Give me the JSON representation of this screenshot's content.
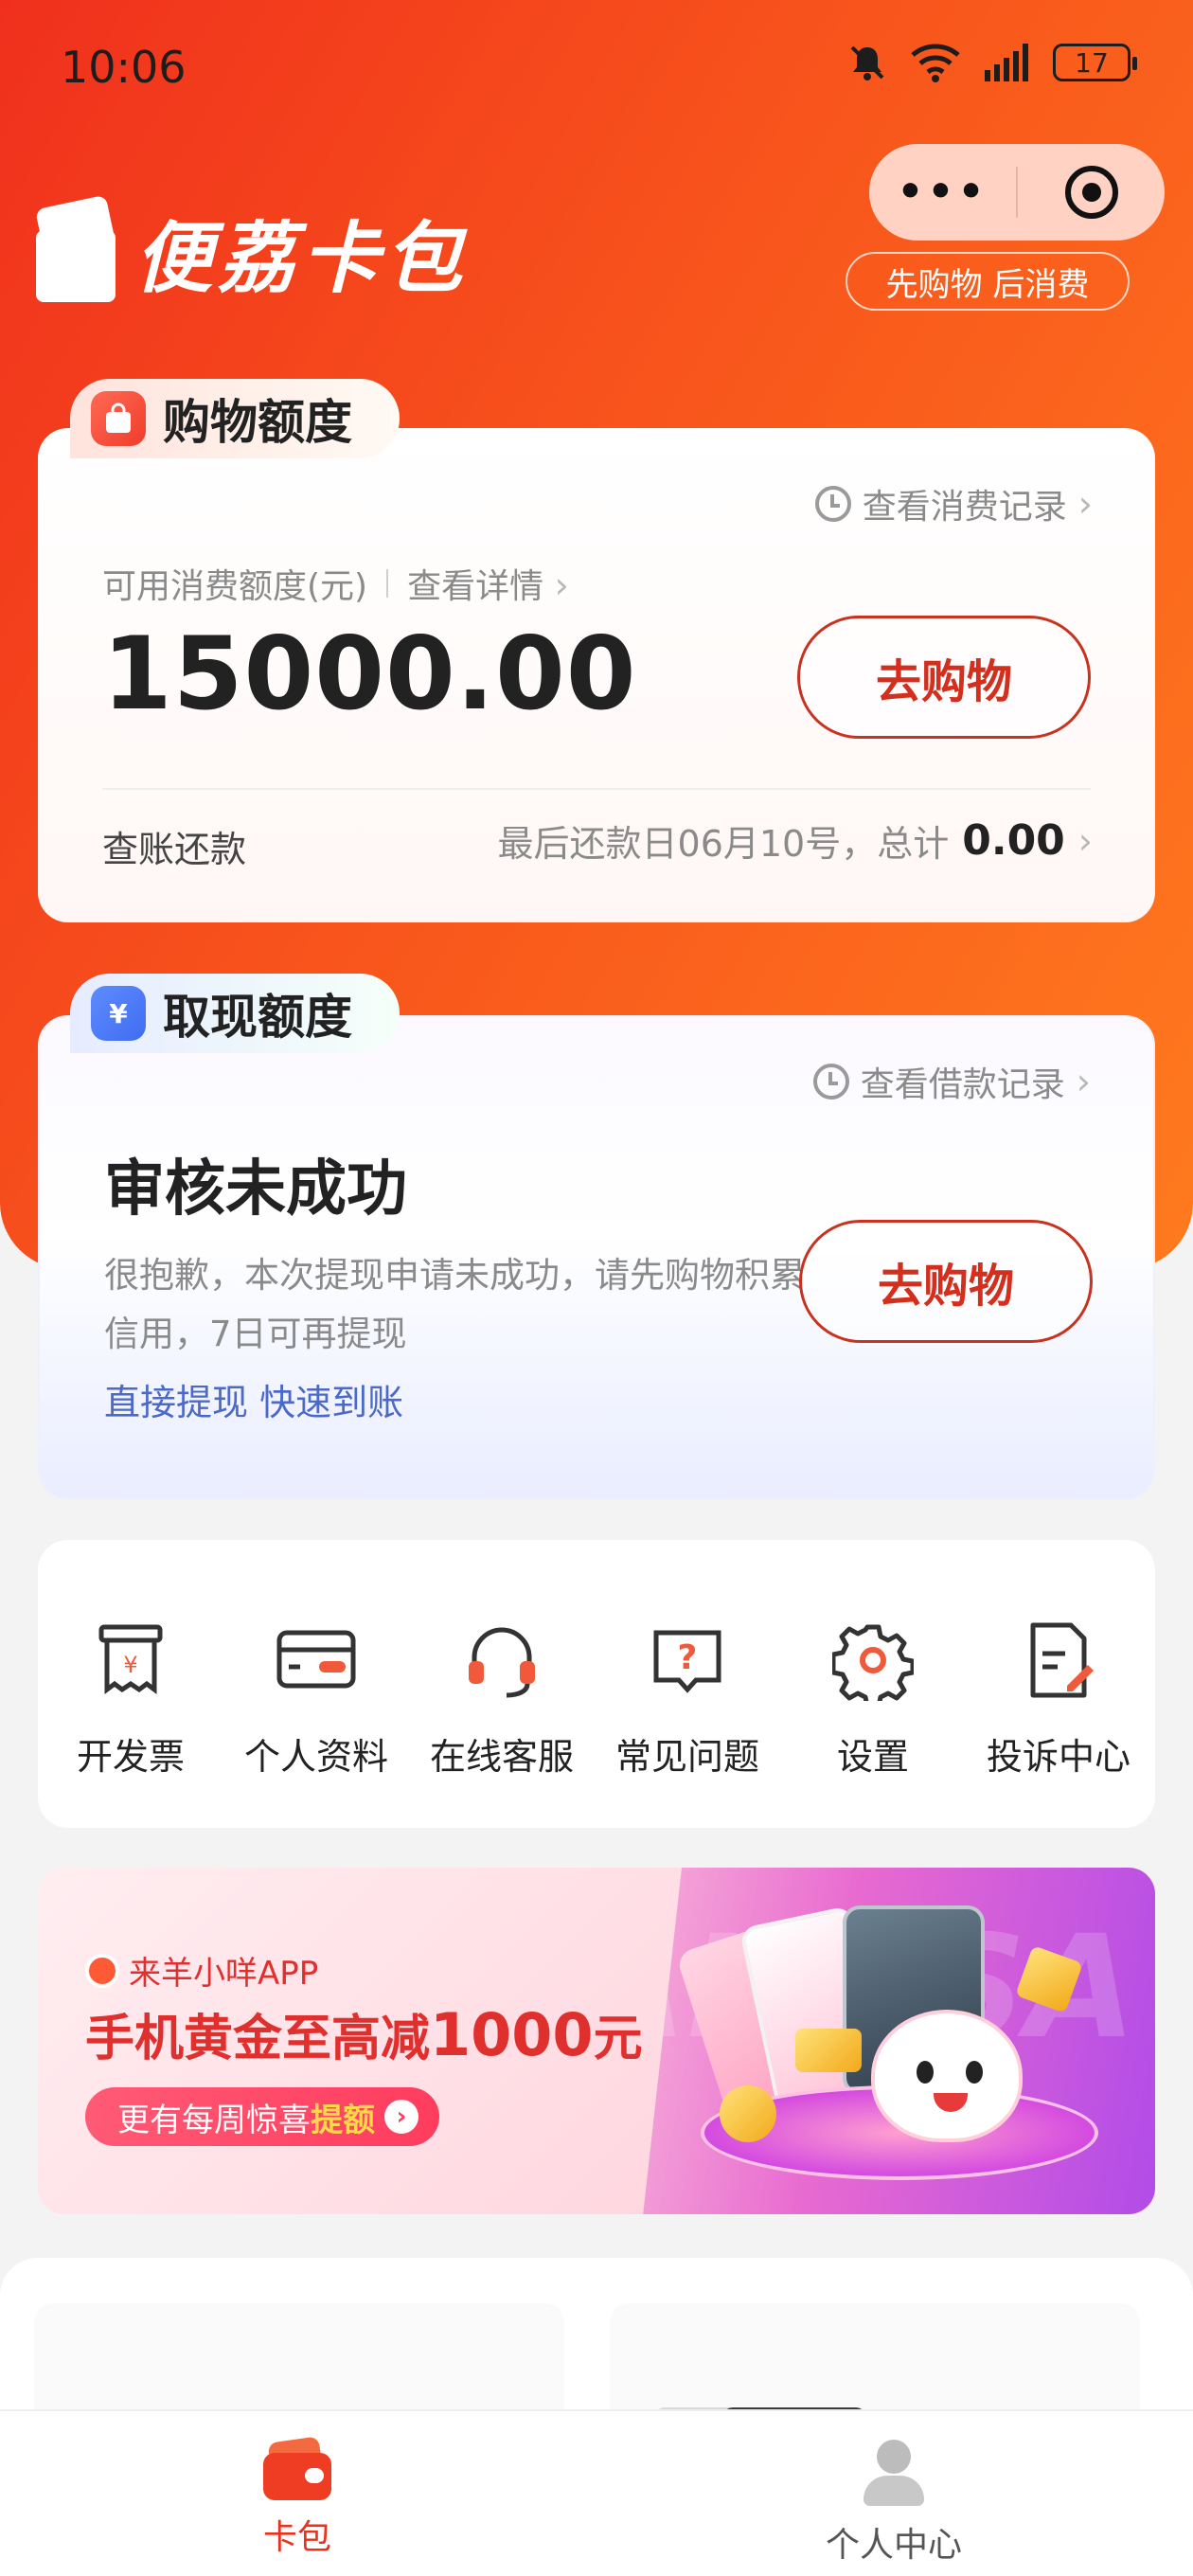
{
  "status_bar": {
    "time": "10:06",
    "battery": "17"
  },
  "header": {
    "logo_text": "便荔卡包",
    "slogan": "先购物 后消费",
    "colors": {
      "gradient_start": "#f0301d",
      "gradient_end": "#ff7a1e"
    }
  },
  "shopping": {
    "tab_title": "购物额度",
    "record_link": "查看消费记录",
    "limit_label": "可用消费额度(元)",
    "detail_link": "查看详情",
    "amount": "15000.00",
    "button": "去购物",
    "bill_label": "查账还款",
    "due_text": "最后还款日06月10号，总计",
    "total": "0.00"
  },
  "withdraw": {
    "tab_title": "取现额度",
    "record_link": "查看借款记录",
    "status_title": "审核未成功",
    "description": "很抱歉，本次提现申请未成功，请先购物积累信用，7日可再提现",
    "link": "直接提现 快速到账",
    "button": "去购物"
  },
  "services": [
    {
      "label": "开发票",
      "icon": "invoice-icon"
    },
    {
      "label": "个人资料",
      "icon": "id-card-icon"
    },
    {
      "label": "在线客服",
      "icon": "headset-icon"
    },
    {
      "label": "常见问题",
      "icon": "question-icon"
    },
    {
      "label": "设置",
      "icon": "gear-icon"
    },
    {
      "label": "投诉中心",
      "icon": "complaint-icon"
    }
  ],
  "banner": {
    "brand": "来羊小咩APP",
    "title_prefix": "手机黄金至高减",
    "title_amount": "1000",
    "title_suffix": "元",
    "pill_text": "更有每周惊喜",
    "pill_highlight": "提额",
    "sale_word": "SALE SA"
  },
  "tab_bar": {
    "items": [
      {
        "label": "卡包",
        "active": true,
        "color": "#e8321e"
      },
      {
        "label": "个人中心",
        "active": false,
        "color": "#555555"
      }
    ]
  }
}
